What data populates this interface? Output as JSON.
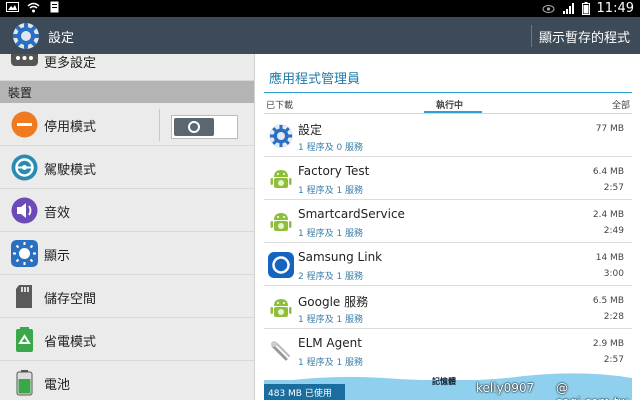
{
  "status_bar": {
    "time": "11:49"
  },
  "action_bar": {
    "title": "設定",
    "action_label": "顯示暫存的程式"
  },
  "settings_list": {
    "top_item": "更多設定",
    "section_header": "裝置",
    "items": [
      {
        "label": "停用模式",
        "icon": "power-saving-minus-icon",
        "color": "#f07a20"
      },
      {
        "label": "駕駛模式",
        "icon": "steering-wheel-icon",
        "color": "#2a8ab0"
      },
      {
        "label": "音效",
        "icon": "speaker-icon",
        "color": "#6b4bb8"
      },
      {
        "label": "顯示",
        "icon": "brightness-icon",
        "color": "#2a6fc0"
      },
      {
        "label": "儲存空間",
        "icon": "sd-card-icon",
        "color": "#555555"
      },
      {
        "label": "省電模式",
        "icon": "recycle-icon",
        "color": "#3aa84a"
      },
      {
        "label": "電池",
        "icon": "battery-icon",
        "color": "#3aa84a"
      }
    ],
    "blocking_mode_toggle": "off"
  },
  "app_manager": {
    "title": "應用程式管理員",
    "tabs": [
      "已下載",
      "執行中",
      "全部"
    ],
    "active_tab": "執行中",
    "apps": [
      {
        "name": "設定",
        "sub": "1 程序及 0 服務",
        "mem": "77 MB",
        "time": "",
        "icon": "settings-gear-icon"
      },
      {
        "name": "Factory Test",
        "sub": "1 程序及 1 服務",
        "mem": "6.4 MB",
        "time": "2:57",
        "icon": "android-icon"
      },
      {
        "name": "SmartcardService",
        "sub": "1 程序及 1 服務",
        "mem": "2.4 MB",
        "time": "2:49",
        "icon": "android-icon"
      },
      {
        "name": "Samsung Link",
        "sub": "2 程序及 1 服務",
        "mem": "14 MB",
        "time": "3:00",
        "icon": "samsung-link-icon"
      },
      {
        "name": "Google 服務",
        "sub": "1 程序及 1 服務",
        "mem": "6.5 MB",
        "time": "2:28",
        "icon": "android-icon"
      },
      {
        "name": "ELM Agent",
        "sub": "1 程序及 1 服務",
        "mem": "2.9 MB",
        "time": "2:57",
        "icon": "elm-agent-icon"
      }
    ]
  },
  "memory_bar": {
    "title": "記憶體",
    "used_label": "483 MB 已使用",
    "used_fraction": 0.22
  },
  "watermark": {
    "user": "kelly0907",
    "site": "@ sogi.com.tw"
  }
}
